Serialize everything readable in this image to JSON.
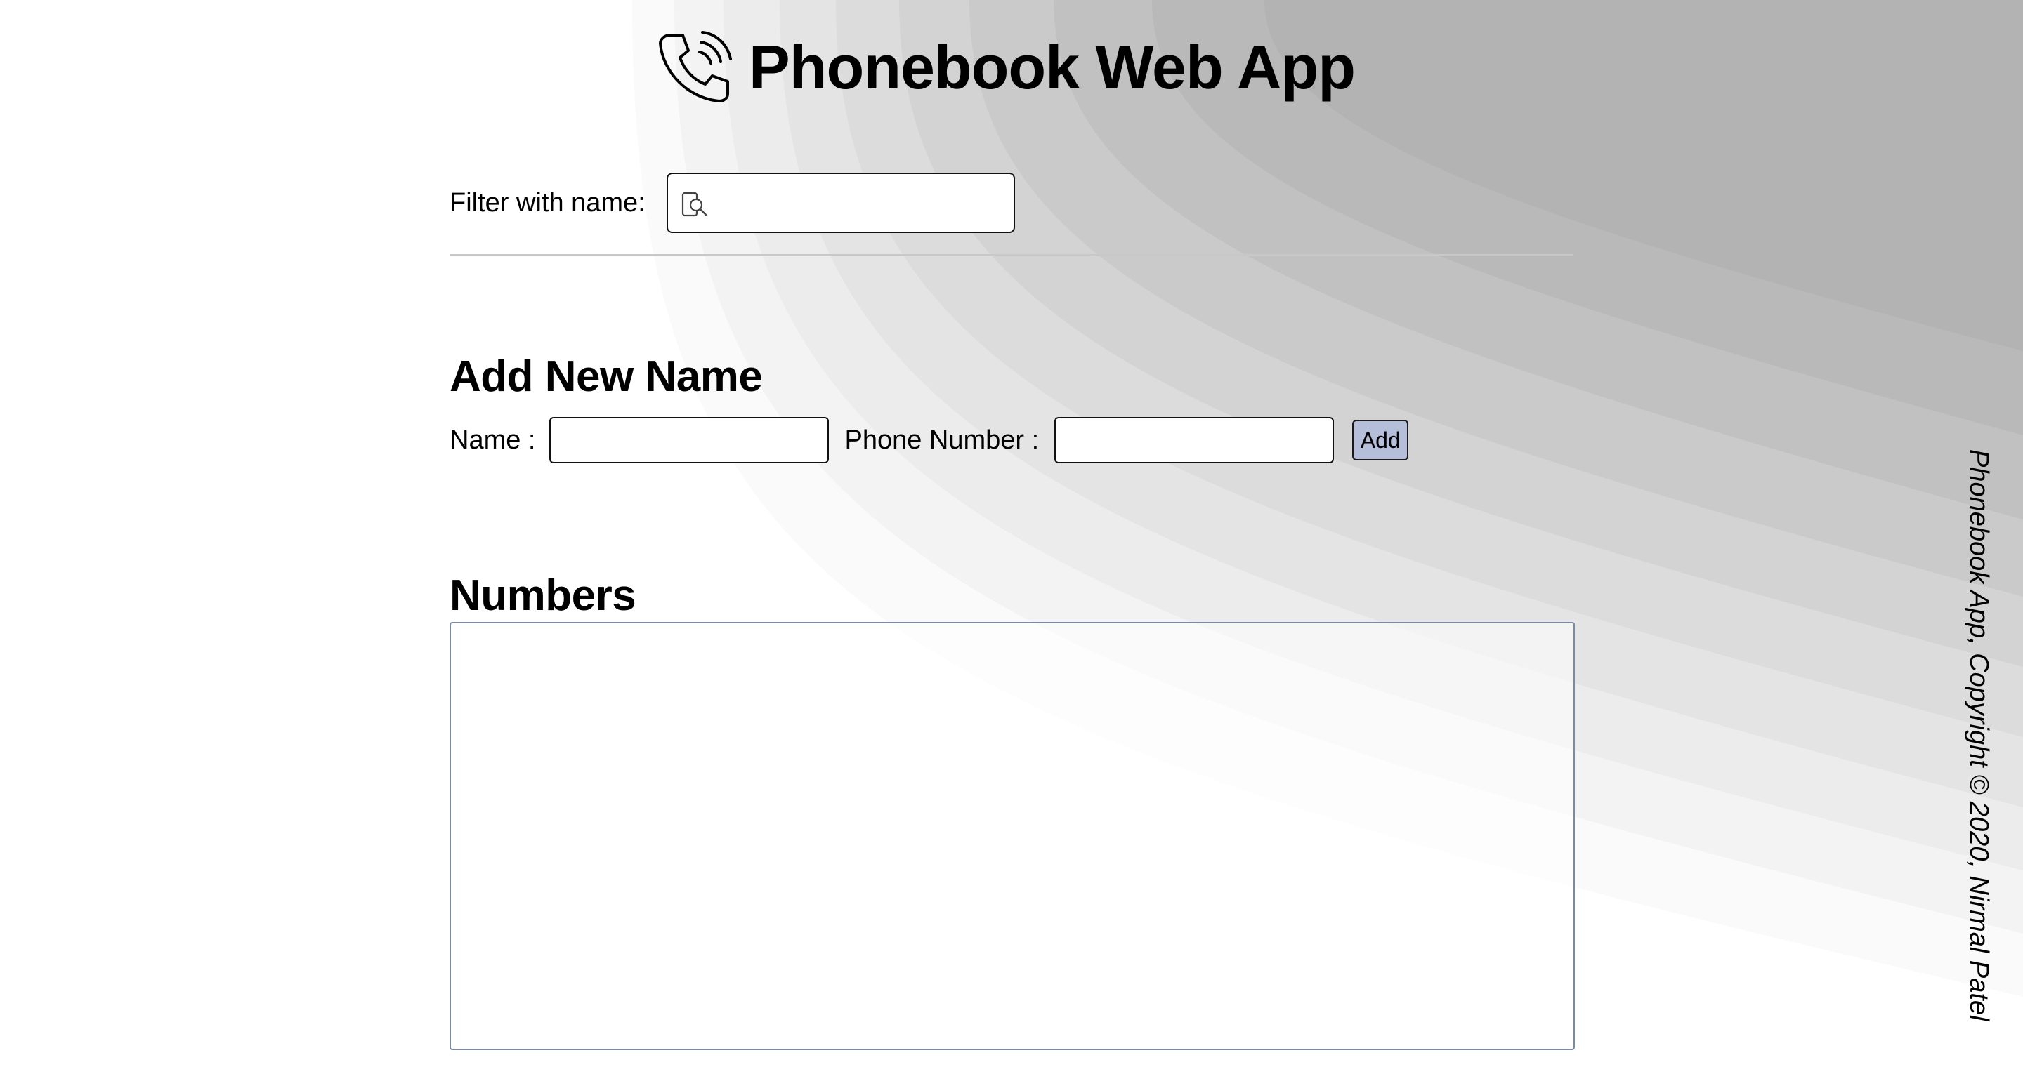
{
  "header": {
    "title": "Phonebook Web App",
    "icon": "phone-ringing-icon"
  },
  "filter": {
    "label": "Filter with name:",
    "value": "",
    "icon": "search-icon"
  },
  "add_section": {
    "heading": "Add New Name",
    "name_label": "Name :",
    "name_value": "",
    "phone_label": "Phone Number :",
    "phone_value": "",
    "add_button_label": "Add"
  },
  "numbers_section": {
    "heading": "Numbers",
    "entries": []
  },
  "footer": {
    "text": "Phonebook App, Copyright  © 2020, Nirmal Patel"
  },
  "colors": {
    "add_button_bg": "#b6bfda",
    "numbers_border": "#7a8aa3",
    "divider": "#c8c8c8"
  }
}
